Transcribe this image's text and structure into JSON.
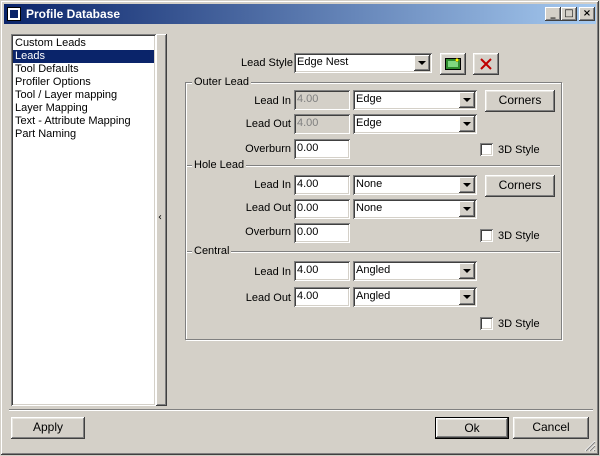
{
  "window": {
    "title": "Profile Database",
    "controls": [
      "_",
      "□",
      "×"
    ]
  },
  "sidebar": {
    "items": [
      {
        "label": "Custom Leads",
        "selected": false
      },
      {
        "label": "Leads",
        "selected": true
      },
      {
        "label": "Tool Defaults",
        "selected": false
      },
      {
        "label": "Profiler Options",
        "selected": false
      },
      {
        "label": "Tool / Layer mapping",
        "selected": false
      },
      {
        "label": "Layer Mapping",
        "selected": false
      },
      {
        "label": "Text - Attribute Mapping",
        "selected": false
      },
      {
        "label": "Part Naming",
        "selected": false
      }
    ],
    "splitter_glyph": "‹"
  },
  "lead_style": {
    "label": "Lead Style",
    "value": "Edge Nest"
  },
  "outer_lead": {
    "title": "Outer Lead",
    "lead_in": {
      "label": "Lead In",
      "value": "4.00",
      "type": "Edge"
    },
    "lead_out": {
      "label": "Lead Out",
      "value": "4.00",
      "type": "Edge"
    },
    "overburn": {
      "label": "Overburn",
      "value": "0.00"
    },
    "corners_label": "Corners",
    "style3d_label": "3D Style"
  },
  "hole_lead": {
    "title": "Hole Lead",
    "lead_in": {
      "label": "Lead In",
      "value": "4.00",
      "type": "None"
    },
    "lead_out": {
      "label": "Lead Out",
      "value": "0.00",
      "type": "None"
    },
    "overburn": {
      "label": "Overburn",
      "value": "0.00"
    },
    "corners_label": "Corners",
    "style3d_label": "3D Style"
  },
  "central": {
    "title": "Central",
    "lead_in": {
      "label": "Lead In",
      "value": "4.00",
      "type": "Angled"
    },
    "lead_out": {
      "label": "Lead Out",
      "value": "4.00",
      "type": "Angled"
    },
    "style3d_label": "3D Style"
  },
  "footer": {
    "apply_label": "Apply",
    "ok_label": "Ok",
    "cancel_label": "Cancel"
  },
  "icons": {
    "new_style": "new-style-icon",
    "delete_style": "delete-icon"
  },
  "colors": {
    "titlebar": "#0a246a",
    "selection": "#0a246a",
    "delete_x": "#c00000"
  }
}
